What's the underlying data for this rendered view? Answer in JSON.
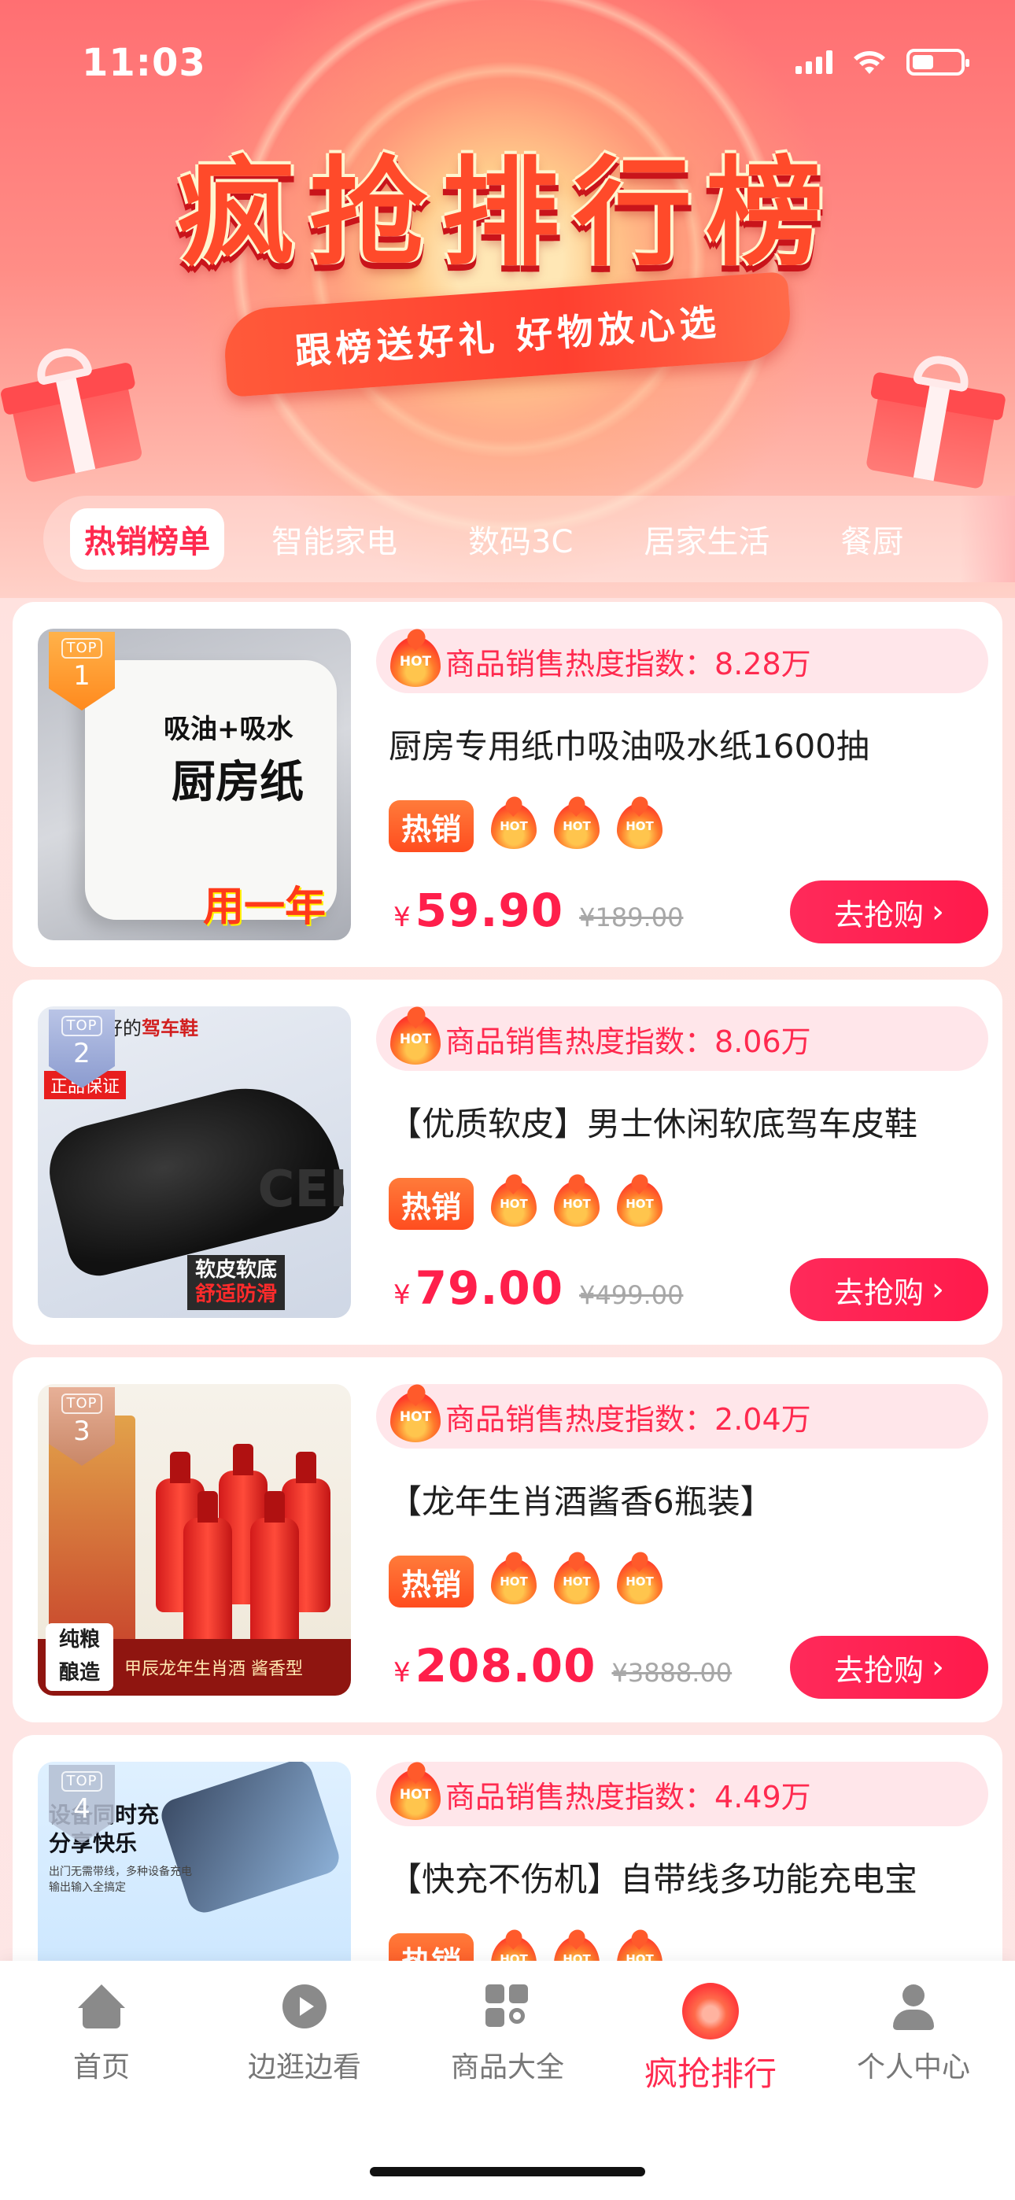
{
  "status": {
    "time": "11:03"
  },
  "hero": {
    "title": "疯抢排行榜",
    "slogan": "跟榜送好礼 好物放心选"
  },
  "tabs": [
    {
      "label": "热销榜单",
      "active": true
    },
    {
      "label": "智能家电",
      "active": false
    },
    {
      "label": "数码3C",
      "active": false
    },
    {
      "label": "居家生活",
      "active": false
    },
    {
      "label": "餐厨",
      "active": false
    }
  ],
  "labels": {
    "heat_prefix": "商品销售热度指数：",
    "hot_tag": "热销",
    "hot_badge": "HOT",
    "buy_button": "去抢购",
    "currency": "¥",
    "top_badge": "TOP"
  },
  "products": [
    {
      "rank": "1",
      "heat": "8.28万",
      "title": "厨房专用纸巾吸油吸水纸1600抽",
      "price": "59.90",
      "original_price": "¥189.00",
      "image_text": {
        "line1": "吸油+吸水",
        "line2": "厨房纸",
        "line3": "用一年"
      }
    },
    {
      "rank": "2",
      "heat": "8.06万",
      "title": "【优质软皮】男士休闲软底驾车皮鞋",
      "price": "79.00",
      "original_price": "¥499.00",
      "image_text": {
        "header_a": "双好的",
        "header_b": "驾车鞋",
        "guarantee": "正品保证",
        "foot1": "软皮软底",
        "foot2": "舒适防滑",
        "brand": "CEI"
      }
    },
    {
      "rank": "3",
      "heat": "2.04万",
      "title": "【龙年生肖酒酱香6瓶装】",
      "price": "208.00",
      "original_price": "¥3888.00",
      "image_text": {
        "badge1": "纯粮",
        "badge2": "酿造",
        "band": "甲辰龙年生肖酒 酱香型"
      }
    },
    {
      "rank": "4",
      "heat": "4.49万",
      "title": "【快充不伤机】自带线多功能充电宝",
      "price": "",
      "original_price": "",
      "image_text": {
        "line1": "设备同时充",
        "line2": "分享快乐",
        "sub1": "出门无需带线，多种设备充电",
        "sub2": "输出输入全搞定"
      }
    }
  ],
  "bottom_nav": [
    {
      "label": "首页",
      "icon": "home-icon",
      "active": false
    },
    {
      "label": "边逛边看",
      "icon": "play-icon",
      "active": false
    },
    {
      "label": "商品大全",
      "icon": "grid-search-icon",
      "active": false
    },
    {
      "label": "疯抢排行",
      "icon": "flame-icon",
      "active": true
    },
    {
      "label": "个人中心",
      "icon": "user-icon",
      "active": false
    }
  ],
  "colors": {
    "accent": "#ff2a4f",
    "hot_orange": "#ff4d1f",
    "heat_bg": "#ffe6ea"
  }
}
